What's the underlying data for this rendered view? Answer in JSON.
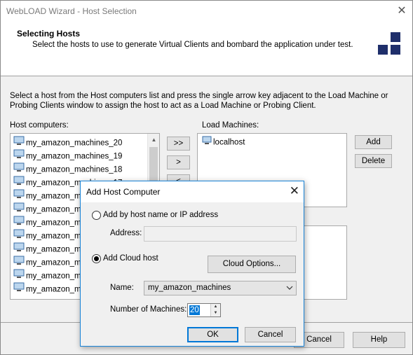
{
  "window": {
    "title": "WebLOAD Wizard - Host Selection",
    "close_glyph": "✕"
  },
  "header": {
    "title": "Selecting Hosts",
    "subtitle": "Select the hosts to use to generate Virtual Clients and bombard the application under test."
  },
  "instructions": "Select a host from the Host computers list and press the single arrow key adjacent to the Load Machine or Probing Clients window to assign the host to act as a Load Machine or Probing Client.",
  "host_computers": {
    "label": "Host computers:",
    "items": [
      "my_amazon_machines_20",
      "my_amazon_machines_19",
      "my_amazon_machines_18",
      "my_amazon_machines_17",
      "my_amazon_ma",
      "my_amazon_ma",
      "my_amazon_ma",
      "my_amazon_ma",
      "my_amazon_ma",
      "my_amazon_ma",
      "my_amazon_ma",
      "my_amazon_ma"
    ]
  },
  "move_buttons": {
    "all": ">>",
    "one": ">",
    "back": "<"
  },
  "load_machines": {
    "label": "Load Machines:",
    "items": [
      "localhost"
    ]
  },
  "side_buttons": {
    "add": "Add",
    "delete": "Delete"
  },
  "footer_buttons": {
    "cancel": "Cancel",
    "help": "Help"
  },
  "dialog": {
    "title": "Add Host Computer",
    "option_hostname": "Add by host name or IP address",
    "address_label": "Address:",
    "address_value": "",
    "option_cloud": "Add Cloud host",
    "cloud_options_button": "Cloud Options...",
    "name_label": "Name:",
    "name_value": "my_amazon_machines",
    "num_label": "Number of Machines:",
    "num_value": "20",
    "ok": "OK",
    "cancel": "Cancel",
    "selected_option": "cloud"
  },
  "colors": {
    "logo": "#1f2f6b",
    "focus": "#0078d7"
  }
}
